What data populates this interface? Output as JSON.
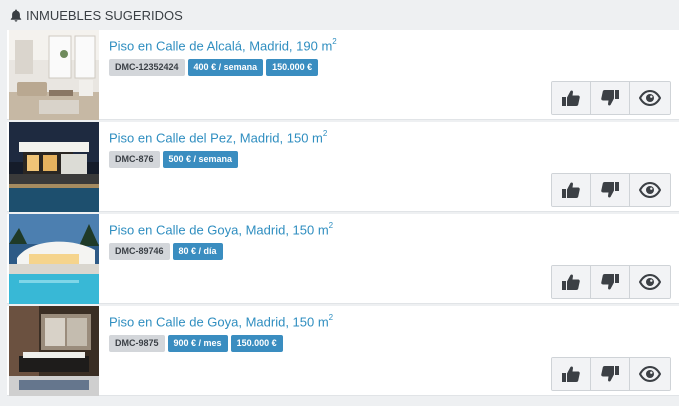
{
  "header": {
    "title": "INMUEBLES SUGERIDOS",
    "icon": "bell-icon"
  },
  "properties": [
    {
      "title": "Piso en Calle de Alcalá, Madrid, 190 m",
      "unit_sup": "2",
      "ref": "DMC-12352424",
      "prices": [
        "400 € / semana",
        "150.000 €"
      ]
    },
    {
      "title": "Piso en Calle del Pez, Madrid, 150 m",
      "unit_sup": "2",
      "ref": "DMC-876",
      "prices": [
        "500 € / semana"
      ]
    },
    {
      "title": "Piso en Calle de Goya, Madrid, 150 m",
      "unit_sup": "2",
      "ref": "DMC-89746",
      "prices": [
        "80 € / día"
      ]
    },
    {
      "title": "Piso en Calle de Goya, Madrid, 150 m",
      "unit_sup": "2",
      "ref": "DMC-9875",
      "prices": [
        "900 € / mes",
        "150.000 €"
      ]
    }
  ],
  "actions": [
    "thumbs-up-icon",
    "thumbs-down-icon",
    "eye-icon"
  ],
  "colors": {
    "link": "#2f8ec0",
    "price_tag": "#3a8dc0",
    "ref_tag": "#d3d6da",
    "background": "#eef0f2"
  }
}
